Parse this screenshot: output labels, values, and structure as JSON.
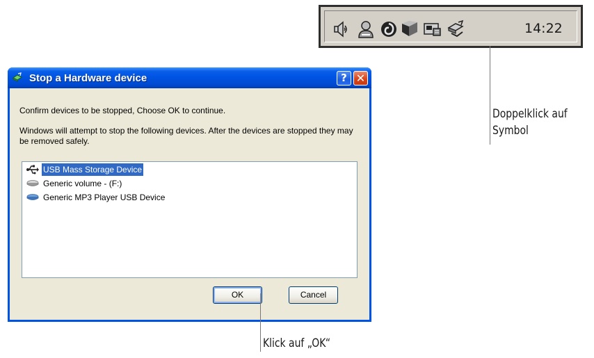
{
  "tray": {
    "clock": "14:22",
    "icons": [
      "speaker-icon",
      "user-icon",
      "swirl-icon",
      "network-icon",
      "pc-card-icon",
      "safely-remove-hardware-icon"
    ]
  },
  "dialog": {
    "title": "Stop a Hardware device",
    "help_button": "?",
    "close_button": "✕",
    "message1": "Confirm devices to be stopped, Choose OK to continue.",
    "message2": "Windows will attempt to stop the following devices. After the devices are stopped they may be removed safely.",
    "devices": [
      {
        "label": "USB Mass Storage Device",
        "icon": "usb-icon",
        "selected": true
      },
      {
        "label": "Generic volume - (F:)",
        "icon": "drive-icon",
        "selected": false
      },
      {
        "label": "Generic MP3 Player USB Device",
        "icon": "drive-icon",
        "selected": false
      }
    ],
    "ok_label": "OK",
    "cancel_label": "Cancel"
  },
  "annotations": {
    "tray_note_line1": "Doppelklick auf",
    "tray_note_line2": "Symbol",
    "ok_note": "Klick auf „OK“"
  },
  "colors": {
    "titlebar": "#0054e3",
    "selection": "#316ac5",
    "client_bg": "#ece9d8"
  }
}
